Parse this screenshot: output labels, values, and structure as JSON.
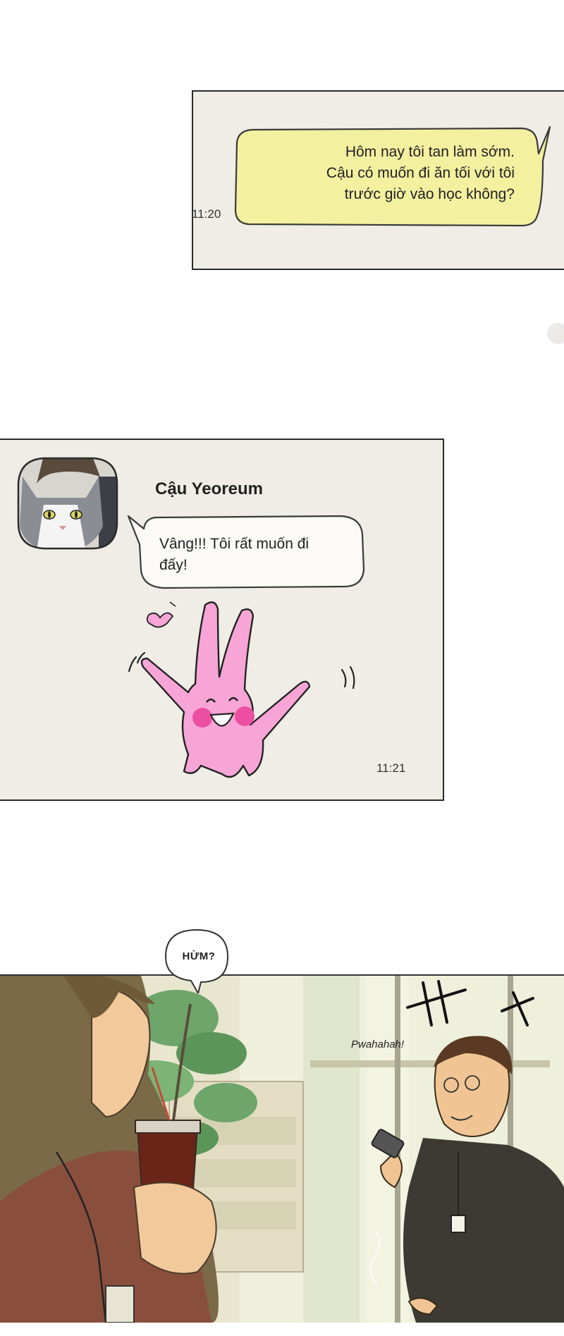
{
  "message_1": {
    "lines": [
      "Hôm nay tôi tan làm sớm.",
      "Cậu có muốn đi ăn tối với tôi",
      "trước giờ vào học không?"
    ],
    "time": "11:20",
    "bubble_color": "#f3f0a0"
  },
  "message_2": {
    "sender": "Cậu Yeoreum",
    "lines": [
      "Vâng!!! Tôi rất muốn đi",
      "đấy!"
    ],
    "time": "11:21",
    "avatar_icon": "cat-avatar-icon",
    "sticker_icon": "pink-bunny-sticker-icon"
  },
  "comic": {
    "sfx_hmm": "HỪM?",
    "sfx_laugh": "Pwahahah!"
  }
}
